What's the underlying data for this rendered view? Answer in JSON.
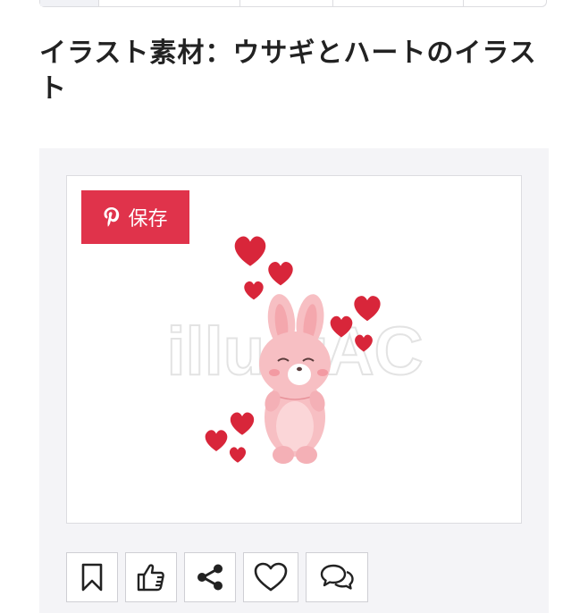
{
  "page": {
    "title": "イラスト素材：ウサギとハートのイラスト"
  },
  "image": {
    "watermark": "illustAC",
    "save_button": {
      "icon": "pinterest-icon",
      "label": "保存",
      "color": "#e0334b"
    }
  },
  "actions": [
    {
      "name": "bookmark-icon"
    },
    {
      "name": "thumbs-up-icon"
    },
    {
      "name": "share-icon"
    },
    {
      "name": "heart-icon"
    },
    {
      "name": "comment-icon"
    }
  ],
  "colors": {
    "panel_bg": "#f4f4f7",
    "heart": "#d8263a",
    "rabbit": "#f7bfc3"
  }
}
